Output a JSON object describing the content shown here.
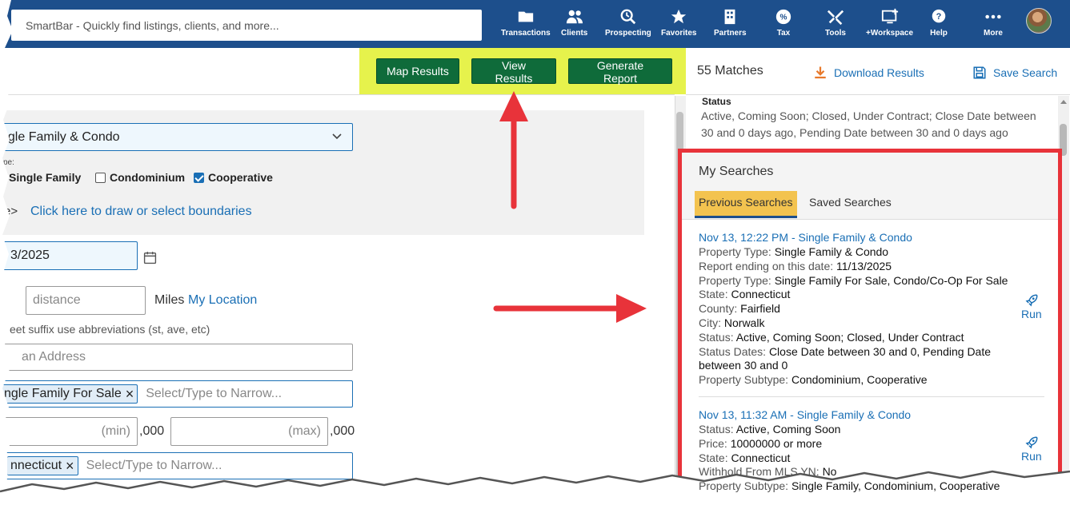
{
  "topbar": {
    "smartbar_placeholder": "SmartBar - Quickly find listings, clients, and more...",
    "nav": [
      {
        "label": "Transactions",
        "icon": "folder-icon"
      },
      {
        "label": "Clients",
        "icon": "people-icon"
      },
      {
        "label": "Prospecting",
        "icon": "search-clock-icon"
      },
      {
        "label": "Favorites",
        "icon": "star-icon"
      },
      {
        "label": "Partners",
        "icon": "building-icon"
      },
      {
        "label": "Tax",
        "icon": "tax-icon"
      },
      {
        "label": "Tools",
        "icon": "tools-icon"
      },
      {
        "label": "+Workspace",
        "icon": "workspace-icon"
      },
      {
        "label": "Help",
        "icon": "help-icon"
      },
      {
        "label": "More",
        "icon": "more-dots-icon"
      }
    ]
  },
  "actions": {
    "map_results": "Map Results",
    "view_results": "View Results",
    "generate_report": "Generate Report"
  },
  "results_header": {
    "matches": "55 Matches",
    "download": "Download Results",
    "save": "Save Search"
  },
  "form": {
    "property_category": "ngle Family & Condo",
    "type_label": "pe:",
    "checkboxes": [
      {
        "label": "Single Family",
        "checked": true
      },
      {
        "label": "Condominium",
        "checked": false
      },
      {
        "label": "Cooperative",
        "checked": true
      }
    ],
    "boundary_prefix": "e>",
    "boundary_link": "Click here to draw or select boundaries",
    "date_value": "3/2025",
    "distance_placeholder": "distance",
    "miles_label": "Miles",
    "my_location": "My Location",
    "street_hint": "eet suffix use abbreviations (st, ave, etc)",
    "address_placeholder": "an Address",
    "listing_tag": "ngle Family For Sale",
    "narrow_placeholder": "Select/Type to Narrow...",
    "price_min_placeholder": "(min)",
    "price_max_placeholder": "(max)",
    "thousands_suffix": ",000",
    "state_tag": "nnecticut",
    "state_narrow_placeholder": "Select/Type to Narrow..."
  },
  "status_summary": {
    "title": "Status",
    "text": "Active, Coming Soon; Closed, Under Contract; Close Date between 30 and 0 days ago, Pending Date between 30 and 0 days ago"
  },
  "my_searches": {
    "title": "My Searches",
    "tabs": [
      "Previous Searches",
      "Saved Searches"
    ],
    "run_label": "Run",
    "entries": [
      {
        "title": "Nov 13, 12:22 PM - Single Family & Condo",
        "lines": [
          {
            "k": "Property Type:",
            "v": "Single Family & Condo"
          },
          {
            "k": "Report ending on this date:",
            "v": "11/13/2025"
          },
          {
            "k": "Property Type:",
            "v": "Single Family For Sale, Condo/Co-Op For Sale"
          },
          {
            "k": "State:",
            "v": "Connecticut"
          },
          {
            "k": "County:",
            "v": "Fairfield"
          },
          {
            "k": "City:",
            "v": "Norwalk"
          },
          {
            "k": "Status:",
            "v": "Active, Coming Soon; Closed, Under Contract"
          },
          {
            "k": "Status Dates:",
            "v": "Close Date between 30 and 0, Pending Date"
          },
          {
            "k": "",
            "v": "between 30 and 0"
          },
          {
            "k": "Property Subtype:",
            "v": "Condominium, Cooperative"
          }
        ]
      },
      {
        "title": "Nov 13, 11:32 AM - Single Family & Condo",
        "lines": [
          {
            "k": "Status:",
            "v": "Active, Coming Soon"
          },
          {
            "k": "Price:",
            "v": "10000000 or more"
          },
          {
            "k": "State:",
            "v": "Connecticut"
          },
          {
            "k": "Withhold From MLS YN:",
            "v": "No"
          },
          {
            "k": "Property Subtype:",
            "v": "Single Family, Condominium, Cooperative"
          }
        ]
      }
    ]
  },
  "colors": {
    "topbar": "#1d4f8c",
    "highlight": "#e6f24c",
    "button_green": "#0f6b3a",
    "link_blue": "#1a6fb5",
    "annotation_red": "#e8333a",
    "tab_active": "#f3c34f"
  }
}
